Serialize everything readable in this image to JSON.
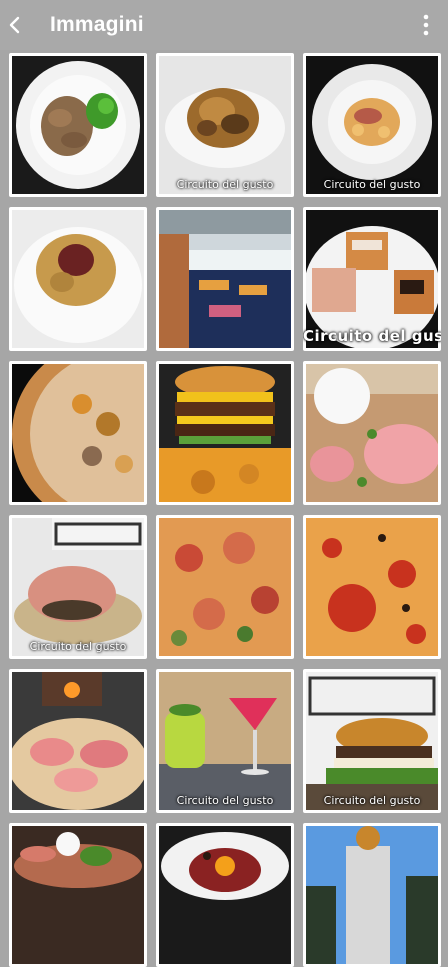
{
  "appbar": {
    "title": "Immagini",
    "back_icon": "chevron-left-icon",
    "menu_icon": "more-vertical-icon"
  },
  "watermark": "Circuito del gusto",
  "colors": {
    "appbar_bg": "#a9a9a9",
    "page_bg": "#a6a6a6",
    "tile_border": "#ffffff"
  },
  "gallery": [
    {
      "subject": "veal slices with green sauce on white plate",
      "watermark": ""
    },
    {
      "subject": "tagliatelle with mushrooms",
      "watermark": "Circuito del gusto"
    },
    {
      "subject": "gnocchi with cured ham",
      "watermark": "Circuito del gusto"
    },
    {
      "subject": "pasta with ragu",
      "watermark": ""
    },
    {
      "subject": "restaurant dining room",
      "watermark": ""
    },
    {
      "subject": "bruschetta platter",
      "watermark": "Circuito del gusto"
    },
    {
      "subject": "pizza with potatoes",
      "watermark": ""
    },
    {
      "subject": "burger with fries",
      "watermark": ""
    },
    {
      "subject": "pizza with burrata and mortadella",
      "watermark": ""
    },
    {
      "subject": "prosciutto pizza",
      "watermark": "Circuito del gusto"
    },
    {
      "subject": "pizza close-up",
      "watermark": ""
    },
    {
      "subject": "pepperoni pizza",
      "watermark": ""
    },
    {
      "subject": "prosciutto pizza by oven",
      "watermark": ""
    },
    {
      "subject": "cocktails",
      "watermark": "Circuito del gusto"
    },
    {
      "subject": "burger",
      "watermark": "Circuito del gusto"
    },
    {
      "subject": "platter with burrata",
      "watermark": ""
    },
    {
      "subject": "tartare with egg yolk",
      "watermark": ""
    },
    {
      "subject": "building exterior with sign",
      "watermark": ""
    }
  ]
}
